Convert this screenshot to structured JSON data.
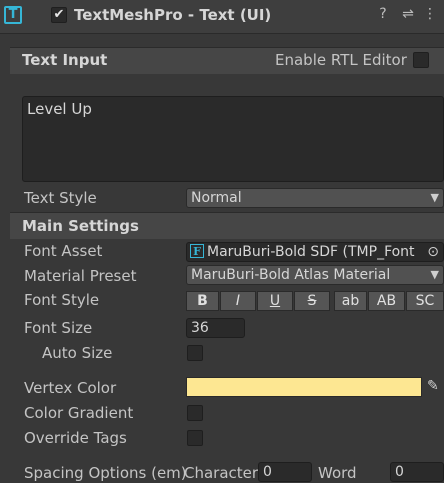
{
  "header": {
    "component_title": "TextMeshPro - Text (UI)",
    "component_icon_glyph": "T",
    "enabled_check": "✔",
    "help_icon": "?",
    "presets_icon": "⇌",
    "menu_icon": "⋮"
  },
  "text_input": {
    "section_label": "Text Input",
    "rtl_label": "Enable RTL Editor",
    "text_value": "Level Up",
    "text_style_label": "Text Style",
    "text_style_value": "Normal"
  },
  "main_settings": {
    "section_label": "Main Settings",
    "font_asset_label": "Font Asset",
    "font_asset_icon": "F",
    "font_asset_value": "MaruBuri-Bold SDF (TMP_Font",
    "material_preset_label": "Material Preset",
    "material_preset_value": "MaruBuri-Bold Atlas Material",
    "font_style_label": "Font Style",
    "font_style_buttons": [
      "B",
      "I",
      "U",
      "S",
      "ab",
      "AB",
      "SC"
    ],
    "font_size_label": "Font Size",
    "font_size_value": "36",
    "auto_size_label": "Auto Size",
    "vertex_color_label": "Vertex Color",
    "vertex_color": "#fde792",
    "color_gradient_label": "Color Gradient",
    "override_tags_label": "Override Tags",
    "spacing_label": "Spacing Options (em)",
    "character_label": "Character",
    "character_value": "0",
    "word_label": "Word",
    "word_value": "0"
  },
  "glyphs": {
    "dropdown_arrow": "▼",
    "object_picker": "⊙",
    "eyedropper": "✎"
  }
}
